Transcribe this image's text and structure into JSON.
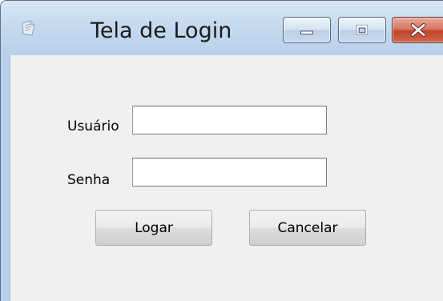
{
  "window": {
    "title": "Tela de Login",
    "icon": "form-icon"
  },
  "caption_buttons": {
    "minimize_icon": "minimize-icon",
    "maximize_icon": "maximize-icon",
    "close_icon": "close-icon",
    "close_color": "#c8432d"
  },
  "form": {
    "user_label": "Usuário",
    "user_value": "",
    "password_label": "Senha",
    "password_value": ""
  },
  "buttons": {
    "login_label": "Logar",
    "cancel_label": "Cancelar"
  }
}
